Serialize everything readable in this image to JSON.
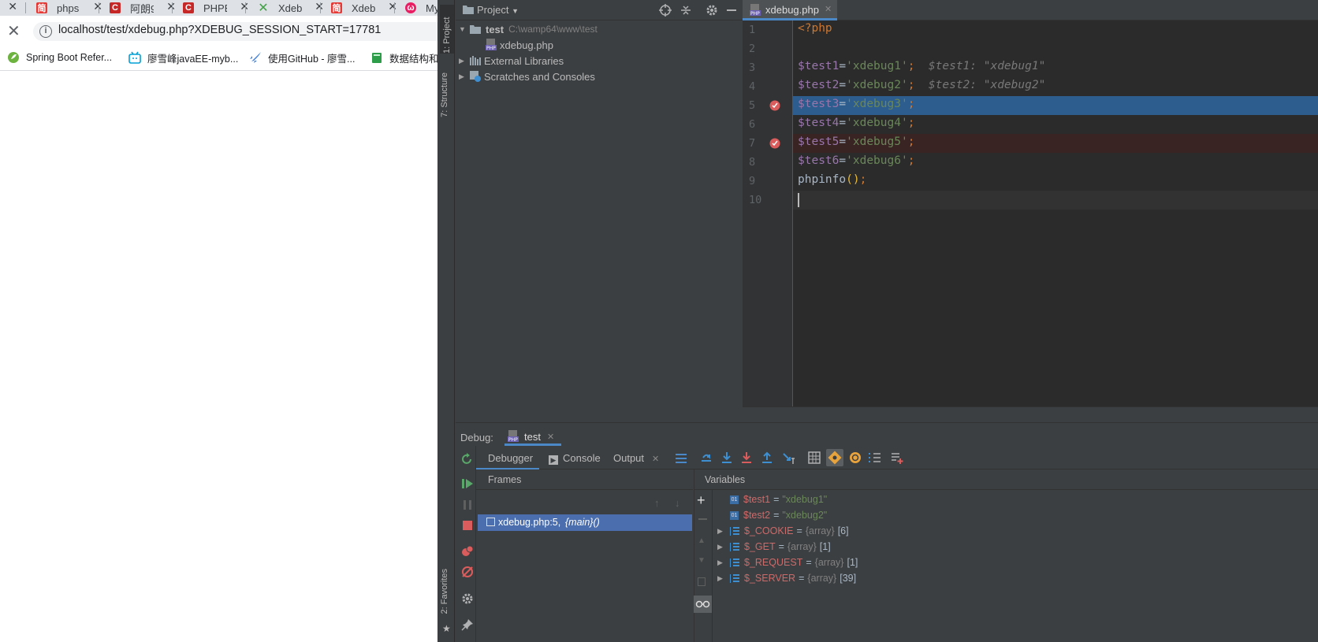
{
  "browser": {
    "tabs": [
      {
        "title": "",
        "favicon": "tab-icon",
        "color": "#dee1e6"
      },
      {
        "title": "phps",
        "favicon": "dev-icon",
        "color": "#e53935"
      },
      {
        "title": "阿朗9",
        "favicon": "csdn-icon",
        "color": "#c62828"
      },
      {
        "title": "PHPE",
        "favicon": "csdn-icon",
        "color": "#c62828"
      },
      {
        "title": "Xdeb",
        "favicon": "x-icon",
        "color": "#43a047"
      },
      {
        "title": "Xdeb",
        "favicon": "dev-icon",
        "color": "#e53935"
      },
      {
        "title": "My",
        "favicon": "cat-icon",
        "color": "#e91e63"
      }
    ],
    "url": "localhost/test/xdebug.php?XDEBUG_SESSION_START=17781",
    "bookmarks": [
      {
        "label": "Spring Boot Refer...",
        "icon": "spring-icon"
      },
      {
        "label": "廖雪峰javaEE-myb...",
        "icon": "bilibili-icon"
      },
      {
        "label": "使用GitHub - 廖雪...",
        "icon": "rocket-icon"
      },
      {
        "label": "数据结构和",
        "icon": "book-icon"
      }
    ]
  },
  "ide": {
    "left_stripe": {
      "project": "1: Project",
      "structure": "7: Structure",
      "favorites": "2: Favorites"
    },
    "project": {
      "title": "Project",
      "root": {
        "name": "test",
        "path": "C:\\wamp64\\www\\test"
      },
      "file": "xdebug.php",
      "external": "External Libraries",
      "scratches": "Scratches and Consoles"
    },
    "editor": {
      "tab": "xdebug.php",
      "line_numbers": [
        "1",
        "2",
        "3",
        "4",
        "5",
        "6",
        "7",
        "8",
        "9",
        "10"
      ],
      "lines": {
        "l1": "<?php",
        "l3": {
          "var": "$test1",
          "eq": "=",
          "str": "'xdebug1'",
          "semi": ";",
          "hint": "$test1: \"xdebug1\""
        },
        "l4": {
          "var": "$test2",
          "eq": "=",
          "str": "'xdebug2'",
          "semi": ";",
          "hint": "$test2: \"xdebug2\""
        },
        "l5": {
          "var": "$test3",
          "eq": "=",
          "str": "'xdebug3'",
          "semi": ";"
        },
        "l6": {
          "var": "$test4",
          "eq": "=",
          "str": "'xdebug4'",
          "semi": ";"
        },
        "l7": {
          "var": "$test5",
          "eq": "=",
          "str": "'xdebug5'",
          "semi": ";"
        },
        "l8": {
          "var": "$test6",
          "eq": "=",
          "str": "'xdebug6'",
          "semi": ";"
        },
        "l9": {
          "fn": "phpinfo",
          "par": "()",
          "semi": ";"
        }
      }
    },
    "debug": {
      "label": "Debug:",
      "session": "test",
      "tabs": {
        "debugger": "Debugger",
        "console": "Console",
        "output": "Output"
      },
      "frames_title": "Frames",
      "frame": {
        "loc": "xdebug.php:5,",
        "fn": "{main}()"
      },
      "variables_title": "Variables",
      "variables": [
        {
          "name": "$test1",
          "value": "\"xdebug1\"",
          "type": "",
          "count": "",
          "expandable": false
        },
        {
          "name": "$test2",
          "value": "\"xdebug2\"",
          "type": "",
          "count": "",
          "expandable": false
        },
        {
          "name": "$_COOKIE",
          "value": "",
          "type": "{array}",
          "count": "[6]",
          "expandable": true
        },
        {
          "name": "$_GET",
          "value": "",
          "type": "{array}",
          "count": "[1]",
          "expandable": true
        },
        {
          "name": "$_REQUEST",
          "value": "",
          "type": "{array}",
          "count": "[1]",
          "expandable": true
        },
        {
          "name": "$_SERVER",
          "value": "",
          "type": "{array}",
          "count": "[39]",
          "expandable": true
        }
      ]
    }
  }
}
